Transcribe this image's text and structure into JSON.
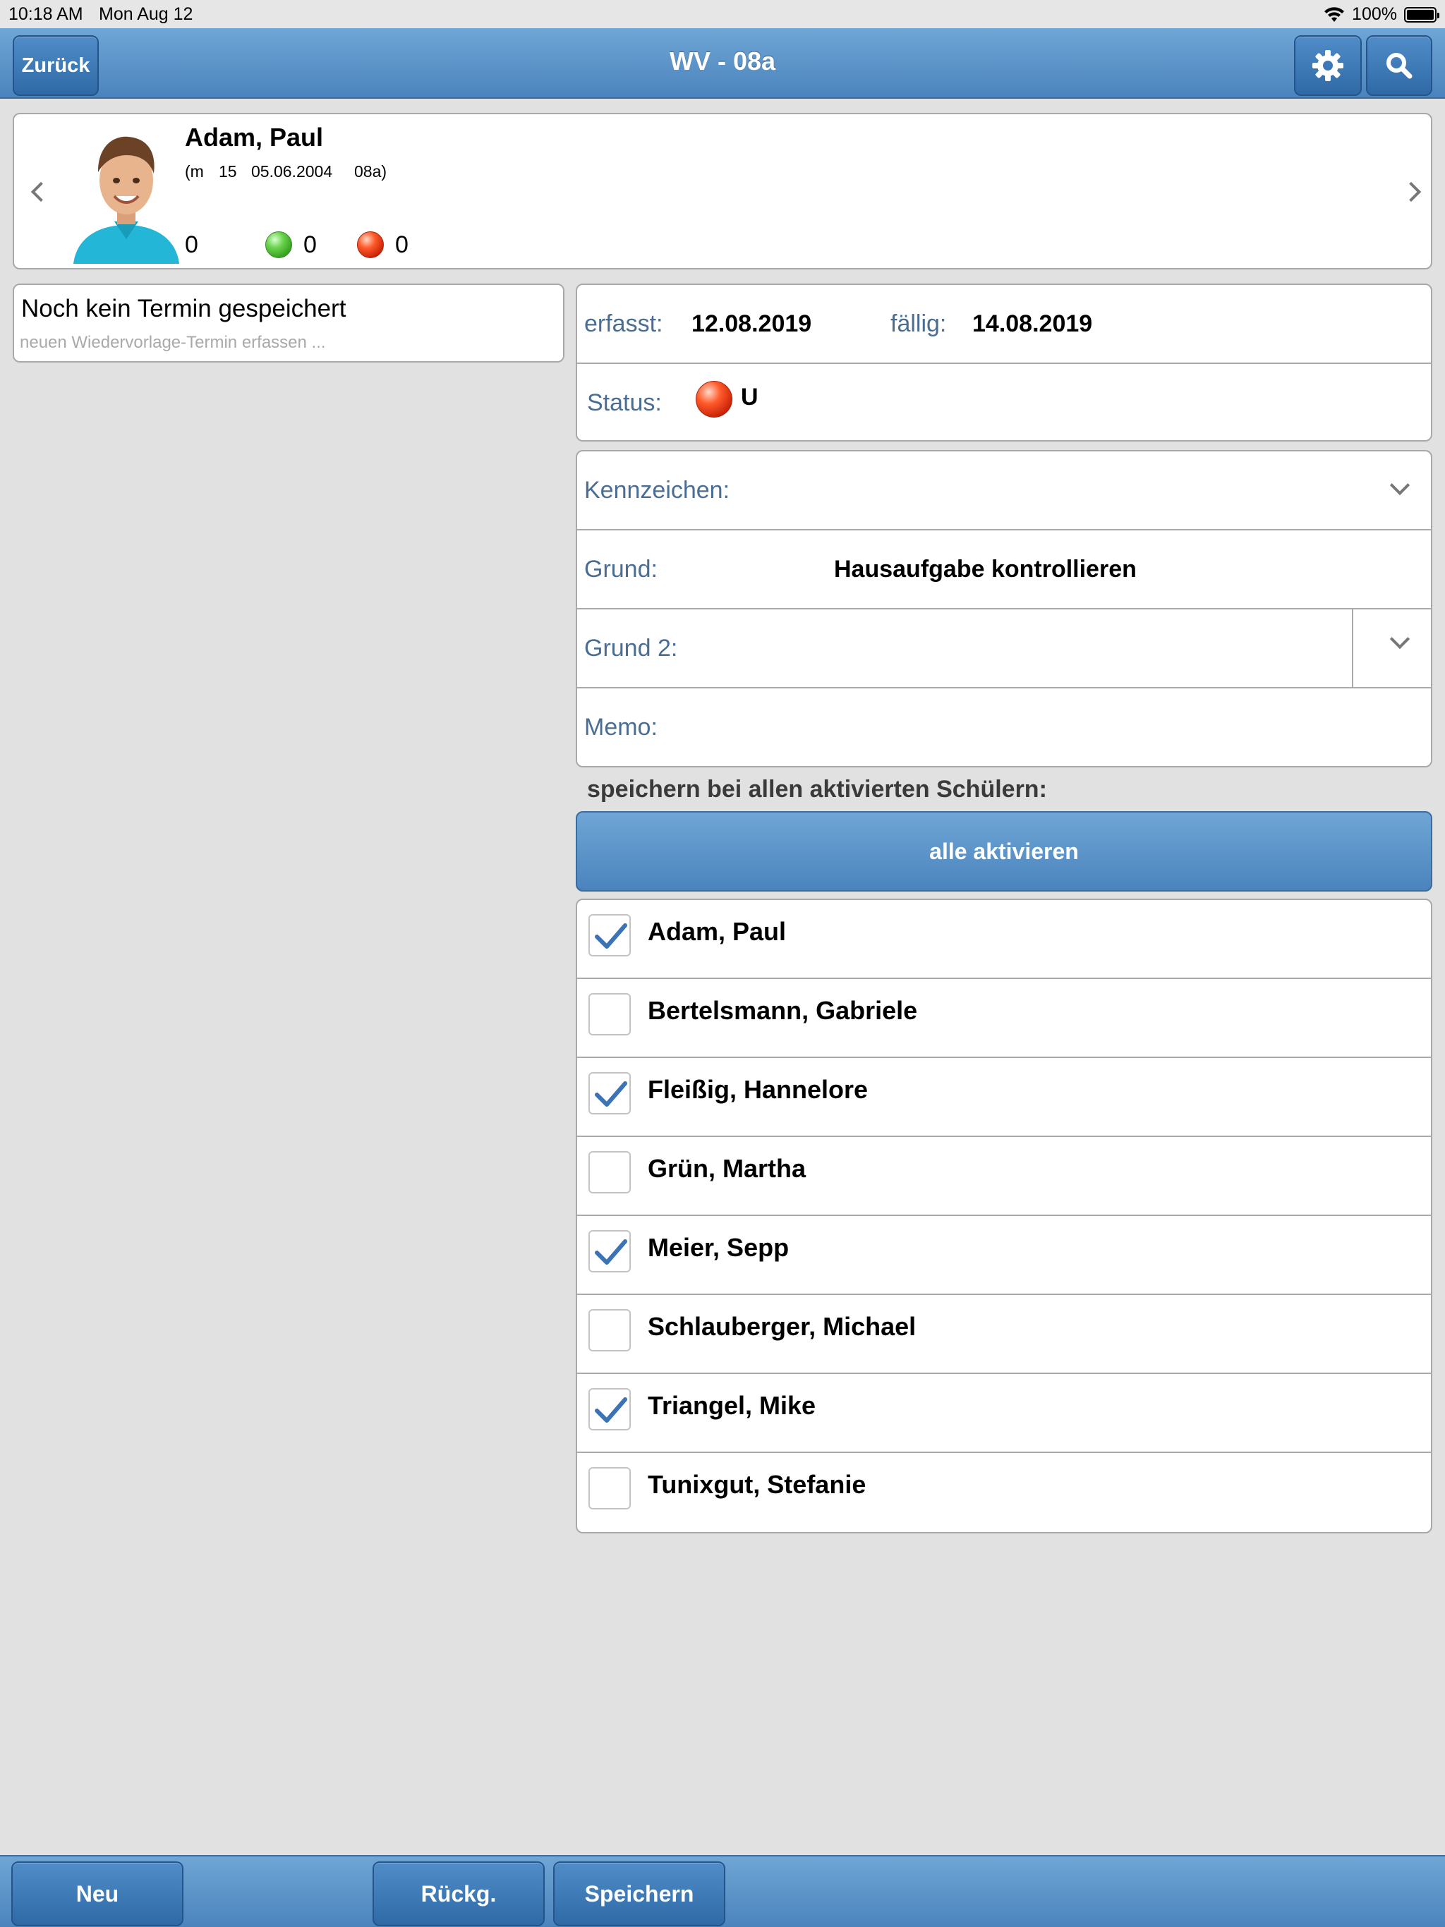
{
  "status_bar": {
    "time": "10:18 AM",
    "date": "Mon Aug 12",
    "battery": "100%"
  },
  "nav": {
    "title": "WV - 08a",
    "back_label": "Zurück",
    "settings_icon": "gear-icon",
    "search_icon": "search-icon"
  },
  "student": {
    "name": "Adam, Paul",
    "details": [
      "(m",
      "15",
      "05.06.2004",
      "08a)"
    ],
    "count_plain": "0",
    "count_green": "0",
    "count_red": "0"
  },
  "termin": {
    "title": "Noch kein Termin gespeichert",
    "hint": "neuen Wiedervorlage-Termin erfassen ..."
  },
  "dates": {
    "erfasst_label": "erfasst:",
    "erfasst_value": "12.08.2019",
    "faellig_label": "fällig:",
    "faellig_value": "14.08.2019",
    "status_label": "Status:",
    "status_value": "U",
    "status_color": "#e8401a"
  },
  "form": {
    "kennzeichen_label": "Kennzeichen:",
    "grund_label": "Grund:",
    "grund_value": "Hausaufgabe kontrollieren",
    "grund2_label": "Grund 2:",
    "memo_label": "Memo:"
  },
  "save_all": {
    "heading": "speichern bei allen aktivierten Schülern:",
    "activate_all_label": "alle aktivieren"
  },
  "students": [
    {
      "name": "Adam, Paul",
      "checked": true
    },
    {
      "name": "Bertelsmann, Gabriele",
      "checked": false
    },
    {
      "name": "Fleißig, Hannelore",
      "checked": true
    },
    {
      "name": "Grün, Martha",
      "checked": false
    },
    {
      "name": "Meier, Sepp",
      "checked": true
    },
    {
      "name": "Schlauberger, Michael",
      "checked": false
    },
    {
      "name": "Triangel, Mike",
      "checked": true
    },
    {
      "name": "Tunixgut, Stefanie",
      "checked": false
    }
  ],
  "toolbar": {
    "new_label": "Neu",
    "back_label": "Rückg.",
    "save_label": "Speichern"
  },
  "colors": {
    "nav_blue": "#4b84bd",
    "button_blue": "#2f6aa6",
    "label_blue": "#4a6d94",
    "check_blue": "#3b73b5"
  }
}
